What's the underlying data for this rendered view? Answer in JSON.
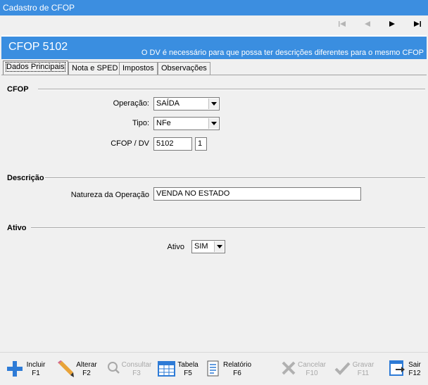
{
  "window": {
    "title": "Cadastro de CFOP"
  },
  "nav": {
    "first_icon": "first-record-icon",
    "prev_icon": "previous-record-icon",
    "next_icon": "next-record-icon",
    "last_icon": "last-record-icon"
  },
  "header": {
    "title": "CFOP 5102",
    "note": "O DV é necessário para que possa ter descrições diferentes para o mesmo CFOP",
    "color": "#3a8ee0"
  },
  "tabs": [
    {
      "label": "Dados Principais",
      "active": true
    },
    {
      "label": "Nota e SPED",
      "active": false
    },
    {
      "label": "Impostos",
      "active": false
    },
    {
      "label": "Observações",
      "active": false
    }
  ],
  "cfop_section": {
    "title": "CFOP",
    "operacao_label": "Operação:",
    "operacao_value": "SAÍDA",
    "tipo_label": "Tipo:",
    "tipo_value": "NFe",
    "cfop_dv_label": "CFOP / DV",
    "cfop_value": "5102",
    "dv_value": "1"
  },
  "descricao_section": {
    "title": "Descrição",
    "natureza_label": "Natureza da Operação",
    "natureza_value": "VENDA NO ESTADO"
  },
  "ativo_section": {
    "title": "Ativo",
    "ativo_label": "Ativo",
    "ativo_value": "SIM"
  },
  "toolbar": {
    "incluir": {
      "label": "Incluir",
      "key": "F1",
      "icon": "plus-icon",
      "enabled": true
    },
    "alterar": {
      "label": "Alterar",
      "key": "F2",
      "icon": "pencil-icon",
      "enabled": true
    },
    "consultar": {
      "label": "Consultar",
      "key": "F3",
      "icon": "magnifier-icon",
      "enabled": false
    },
    "tabela": {
      "label": "Tabela",
      "key": "F5",
      "icon": "table-icon",
      "enabled": true
    },
    "relatorio": {
      "label": "Relatório",
      "key": "F6",
      "icon": "report-icon",
      "enabled": true
    },
    "cancelar": {
      "label": "Cancelar",
      "key": "F10",
      "icon": "cancel-x-icon",
      "enabled": false
    },
    "gravar": {
      "label": "Gravar",
      "key": "F11",
      "icon": "checkmark-icon",
      "enabled": false
    },
    "sair": {
      "label": "Sair",
      "key": "F12",
      "icon": "exit-icon",
      "enabled": true
    }
  }
}
